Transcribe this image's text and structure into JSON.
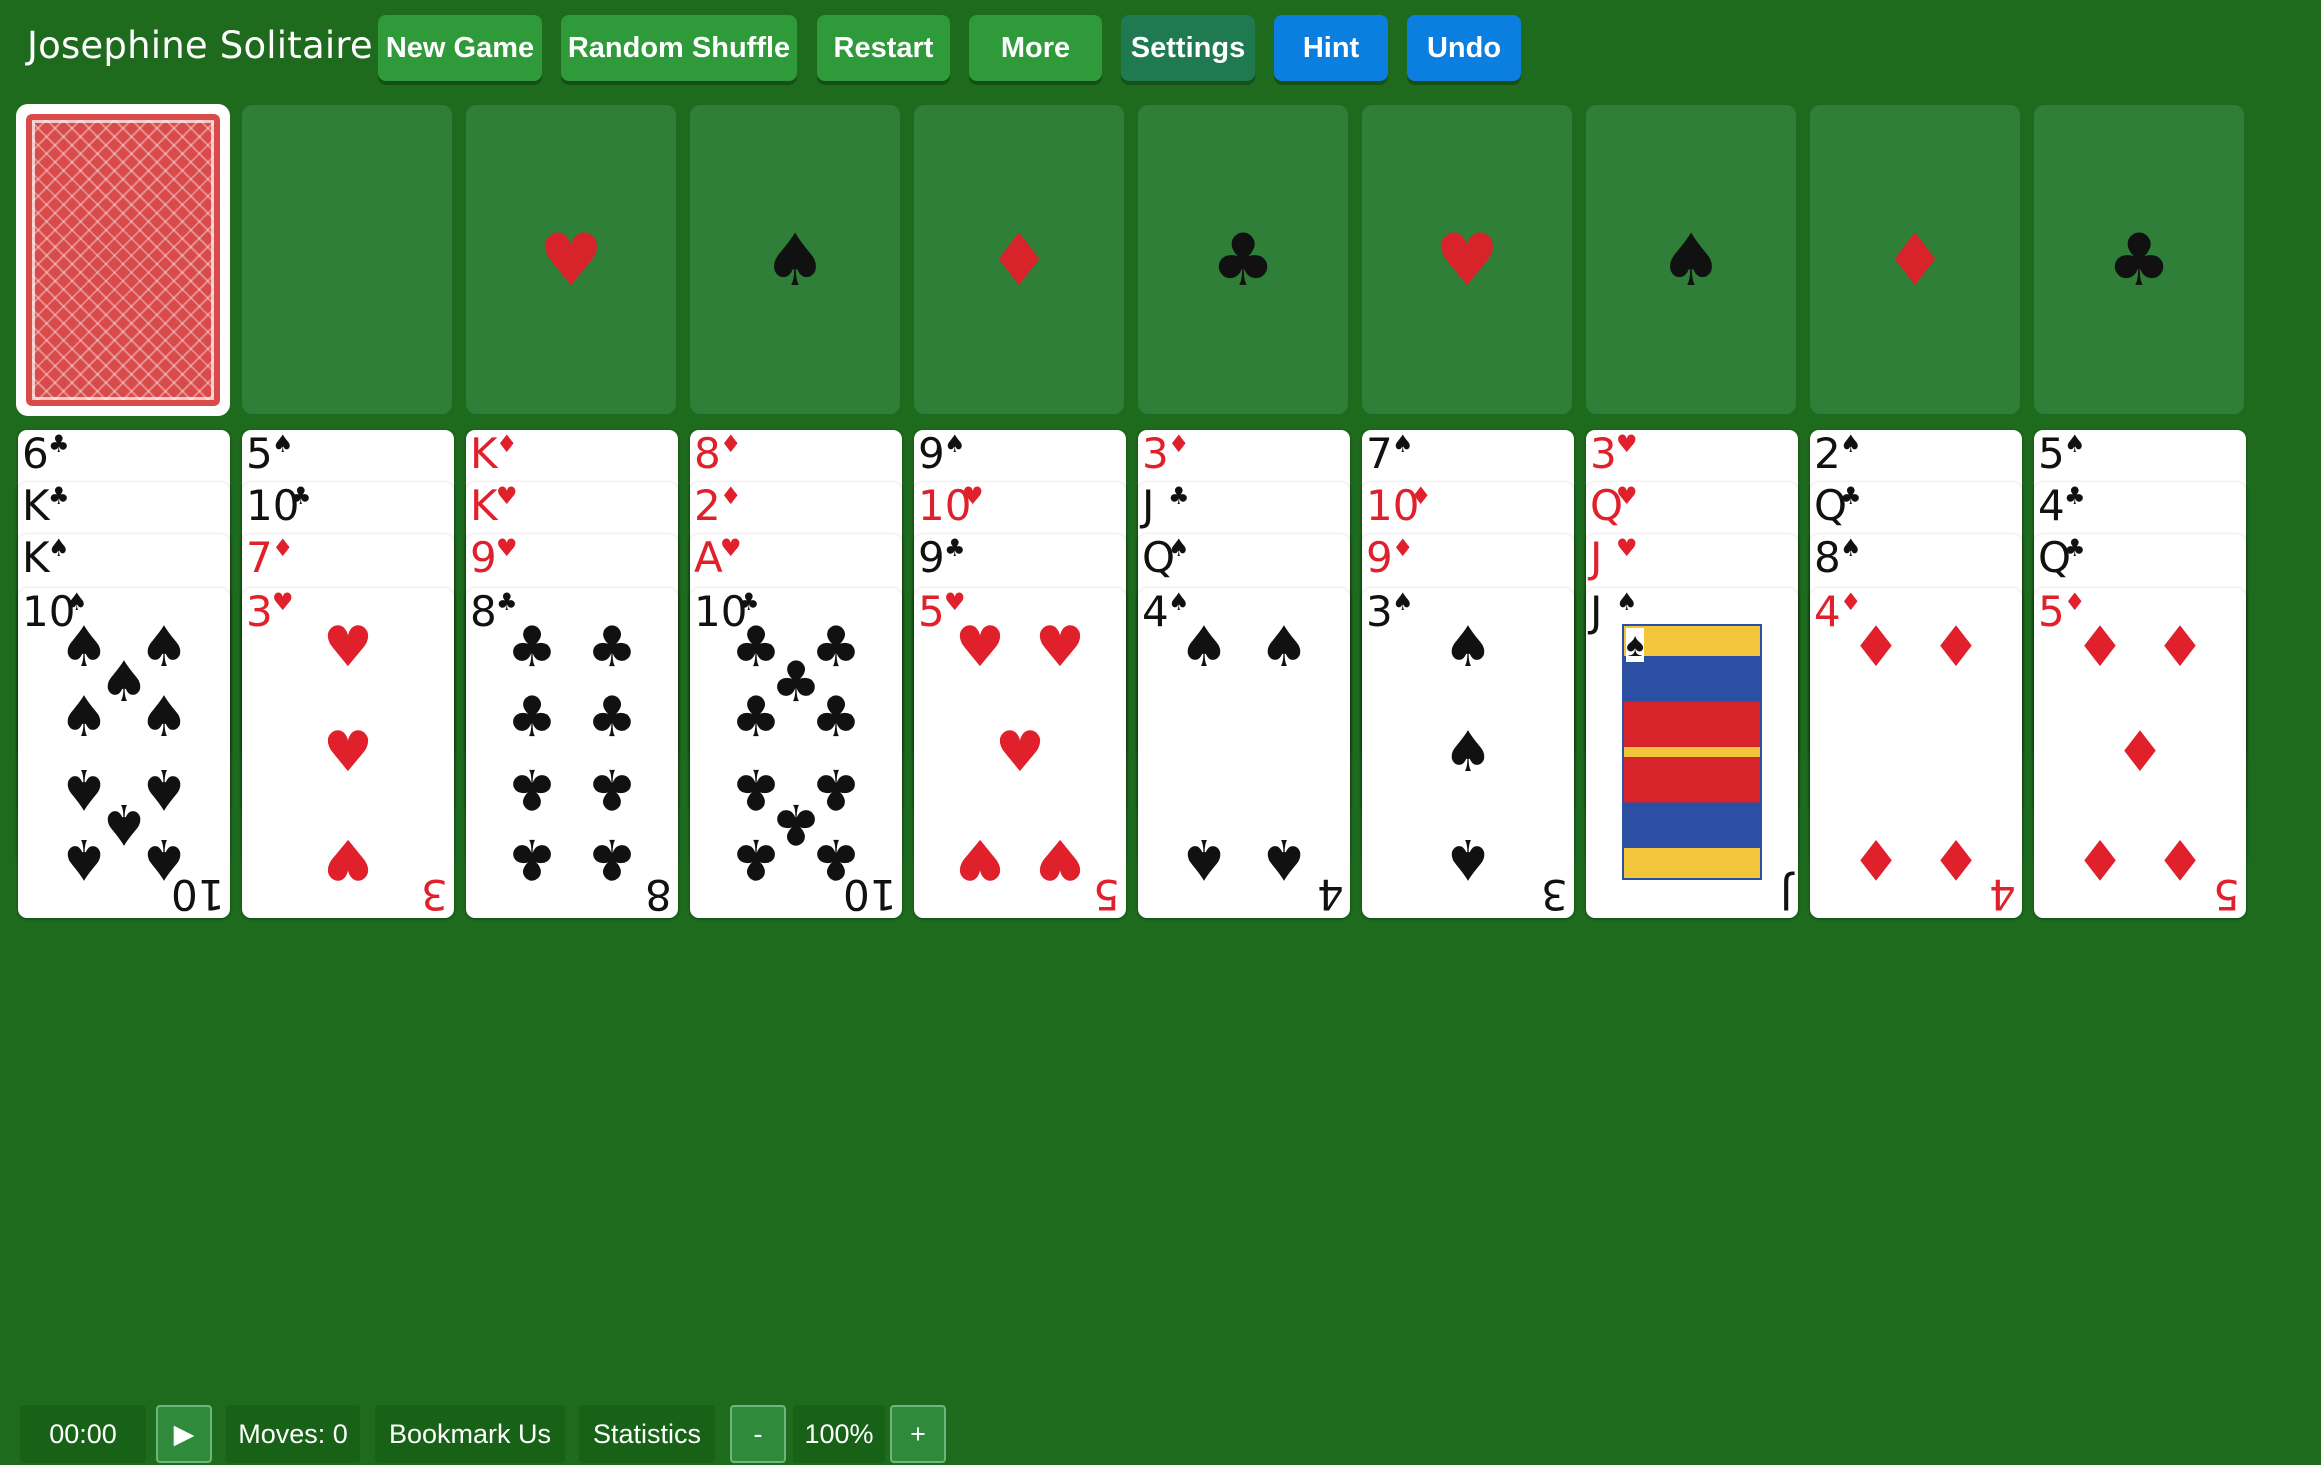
{
  "header": {
    "title": "Josephine Solitaire",
    "buttons": [
      {
        "label": "New Game",
        "style": "green"
      },
      {
        "label": "Random Shuffle",
        "style": "green"
      },
      {
        "label": "Restart",
        "style": "green"
      },
      {
        "label": "More",
        "style": "green"
      },
      {
        "label": "Settings",
        "style": "teal"
      },
      {
        "label": "Hint",
        "style": "blue"
      },
      {
        "label": "Undo",
        "style": "blue"
      }
    ]
  },
  "foundations": [
    {
      "suit": "♥",
      "color": "red",
      "name": "hearts"
    },
    {
      "suit": "♠",
      "color": "black",
      "name": "spades"
    },
    {
      "suit": "♦",
      "color": "red",
      "name": "diamonds"
    },
    {
      "suit": "♣",
      "color": "black",
      "name": "clubs"
    },
    {
      "suit": "♥",
      "color": "red",
      "name": "hearts"
    },
    {
      "suit": "♠",
      "color": "black",
      "name": "spades"
    },
    {
      "suit": "♦",
      "color": "red",
      "name": "diamonds"
    },
    {
      "suit": "♣",
      "color": "black",
      "name": "clubs"
    }
  ],
  "tableau": [
    [
      {
        "rank": "6",
        "suit": "♣"
      },
      {
        "rank": "K",
        "suit": "♣"
      },
      {
        "rank": "K",
        "suit": "♠"
      },
      {
        "rank": "10",
        "suit": "♠"
      }
    ],
    [
      {
        "rank": "5",
        "suit": "♠"
      },
      {
        "rank": "10",
        "suit": "♣"
      },
      {
        "rank": "7",
        "suit": "♦"
      },
      {
        "rank": "3",
        "suit": "♥"
      }
    ],
    [
      {
        "rank": "K",
        "suit": "♦"
      },
      {
        "rank": "K",
        "suit": "♥"
      },
      {
        "rank": "9",
        "suit": "♥"
      },
      {
        "rank": "8",
        "suit": "♣"
      }
    ],
    [
      {
        "rank": "8",
        "suit": "♦"
      },
      {
        "rank": "2",
        "suit": "♦"
      },
      {
        "rank": "A",
        "suit": "♥"
      },
      {
        "rank": "10",
        "suit": "♣"
      }
    ],
    [
      {
        "rank": "9",
        "suit": "♠"
      },
      {
        "rank": "10",
        "suit": "♥"
      },
      {
        "rank": "9",
        "suit": "♣"
      },
      {
        "rank": "5",
        "suit": "♥"
      }
    ],
    [
      {
        "rank": "3",
        "suit": "♦"
      },
      {
        "rank": "J",
        "suit": "♣"
      },
      {
        "rank": "Q",
        "suit": "♠"
      },
      {
        "rank": "4",
        "suit": "♠"
      }
    ],
    [
      {
        "rank": "7",
        "suit": "♠"
      },
      {
        "rank": "10",
        "suit": "♦"
      },
      {
        "rank": "9",
        "suit": "♦"
      },
      {
        "rank": "3",
        "suit": "♠"
      }
    ],
    [
      {
        "rank": "3",
        "suit": "♥"
      },
      {
        "rank": "Q",
        "suit": "♥"
      },
      {
        "rank": "J",
        "suit": "♥"
      },
      {
        "rank": "J",
        "suit": "♠"
      }
    ],
    [
      {
        "rank": "2",
        "suit": "♠"
      },
      {
        "rank": "Q",
        "suit": "♣"
      },
      {
        "rank": "8",
        "suit": "♠"
      },
      {
        "rank": "4",
        "suit": "♦"
      }
    ],
    [
      {
        "rank": "5",
        "suit": "♠"
      },
      {
        "rank": "4",
        "suit": "♣"
      },
      {
        "rank": "Q",
        "suit": "♣"
      },
      {
        "rank": "5",
        "suit": "♦"
      }
    ]
  ],
  "footer": {
    "timer": "00:00",
    "play_icon": "▶",
    "moves": "Moves: 0",
    "bookmark": "Bookmark Us",
    "statistics": "Statistics",
    "zoom_out": "-",
    "zoom": "100%",
    "zoom_in": "+"
  }
}
